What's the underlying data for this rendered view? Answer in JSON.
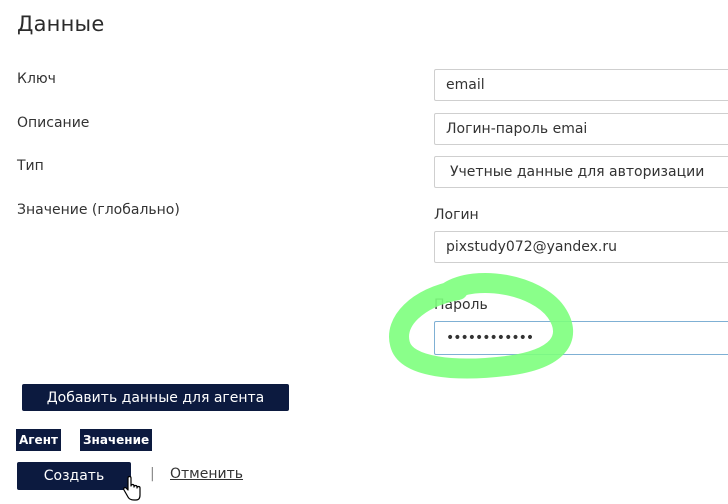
{
  "section": {
    "title": "Данные"
  },
  "form": {
    "key_label": "Ключ",
    "key_value": "email",
    "description_label": "Описание",
    "description_value": "Логин-пароль emai",
    "type_label": "Тип",
    "type_value": "Учетные данные для авторизации",
    "value_label": "Значение (глобально)",
    "login_label": "Логин",
    "login_value": "pixstudy072@yandex.ru",
    "password_label": "Пароль",
    "password_value": "••••••••••••"
  },
  "agent": {
    "add_button": "Добавить данные для агента",
    "columns": [
      "Агент",
      "Значение"
    ]
  },
  "actions": {
    "create": "Создать",
    "separator": "|",
    "cancel": "Отменить"
  },
  "colors": {
    "primary_dark": "#0c1a3f",
    "highlight": "#7dff7d"
  }
}
